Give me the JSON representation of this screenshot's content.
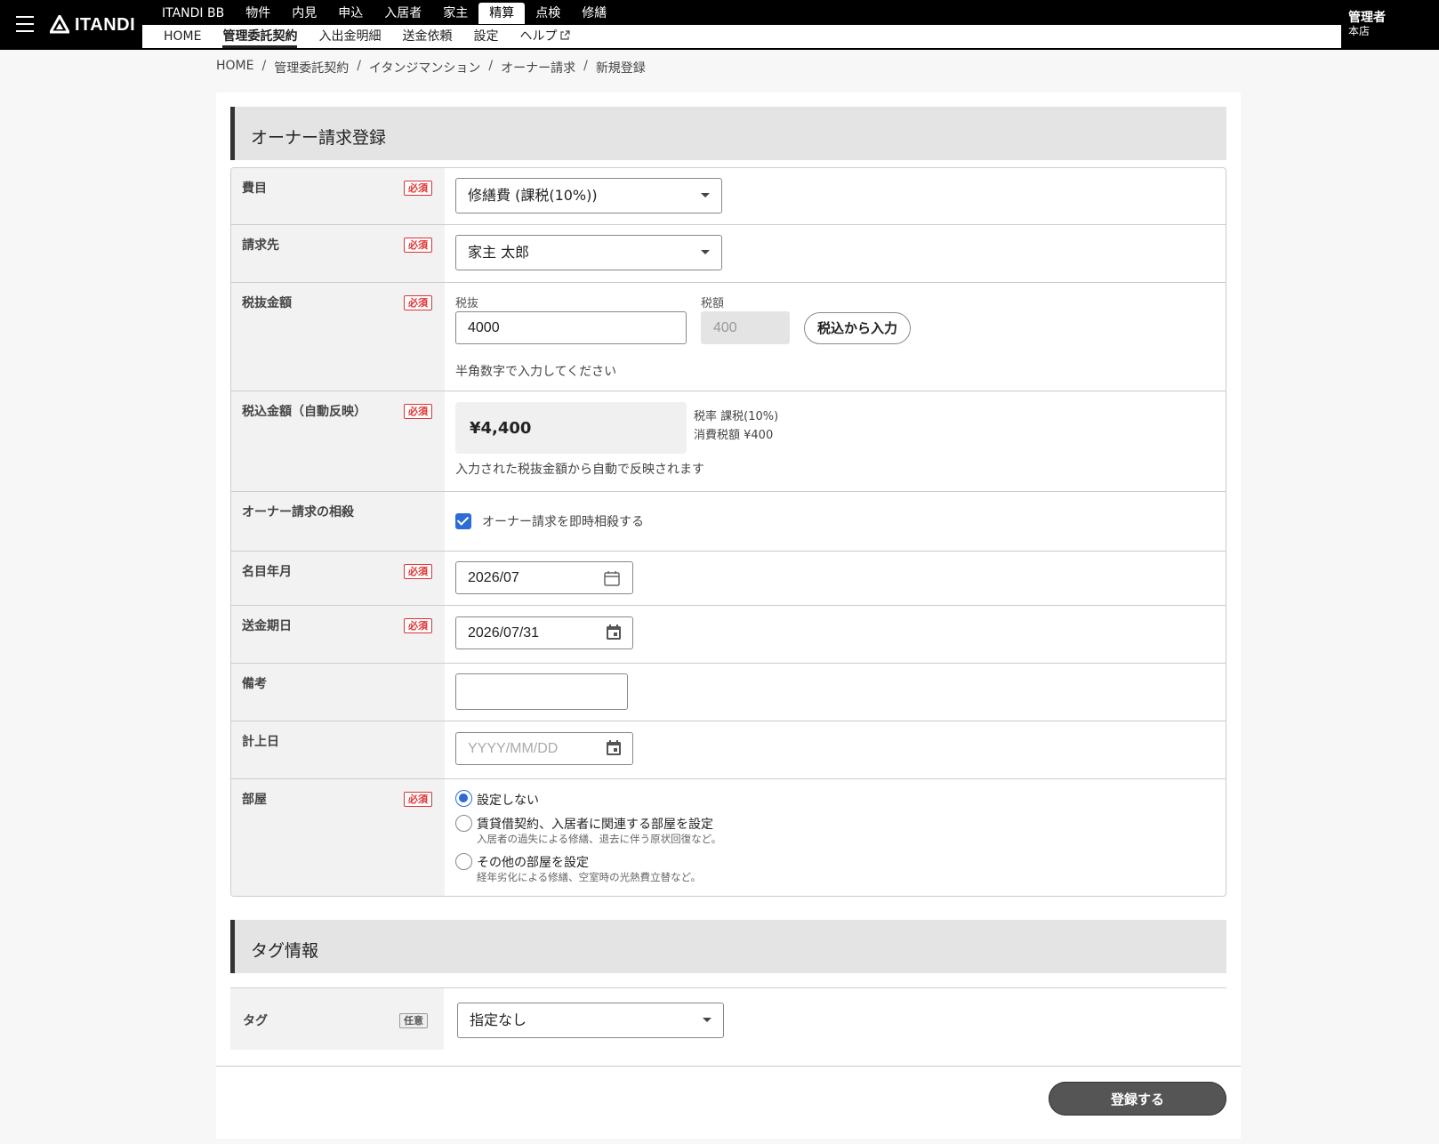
{
  "header": {
    "logo_text": "ITANDI",
    "top_nav": [
      "ITANDI BB",
      "物件",
      "内見",
      "申込",
      "入居者",
      "家主",
      "精算",
      "点検",
      "修繕"
    ],
    "top_nav_active": "精算",
    "sub_nav": [
      "HOME",
      "管理委託契約",
      "入出金明細",
      "送金依頼",
      "設定",
      "ヘルプ"
    ],
    "sub_nav_active": "管理委託契約",
    "user_role": "管理者",
    "user_branch": "本店"
  },
  "breadcrumb": [
    "HOME",
    "管理委託契約",
    "イタンジマンション",
    "オーナー請求",
    "新規登録"
  ],
  "breadcrumb_separator": "/",
  "section_title": "オーナー請求登録",
  "required_badge": "必須",
  "optional_badge": "任意",
  "fields": {
    "expense_item": {
      "label": "費目",
      "value": "修繕費 (課税(10%))"
    },
    "billing_to": {
      "label": "請求先",
      "value": "家主 太郎"
    },
    "amount_excl": {
      "label": "税抜金額",
      "excl_label": "税抜",
      "excl_value": "4000",
      "tax_label": "税額",
      "tax_value": "400",
      "button_label": "税込から入力",
      "hint": "半角数字で入力してください"
    },
    "amount_incl": {
      "label": "税込金額（自動反映）",
      "value": "¥4,400",
      "tax_rate": "税率 課税(10%)",
      "tax_amount": "消費税額 ¥400",
      "hint": "入力された税抜金額から自動で反映されます"
    },
    "offset": {
      "label": "オーナー請求の相殺",
      "checkbox_label": "オーナー請求を即時相殺する",
      "checked": true
    },
    "nominal_month": {
      "label": "名目年月",
      "value": "2026/07"
    },
    "transfer_date": {
      "label": "送金期日",
      "value": "2026/07/31"
    },
    "remarks": {
      "label": "備考",
      "value": ""
    },
    "posting_date": {
      "label": "計上日",
      "placeholder": "YYYY/MM/DD"
    },
    "room": {
      "label": "部屋",
      "options": [
        {
          "label": "設定しない",
          "sub": "",
          "selected": true
        },
        {
          "label": "賃貸借契約、入居者に関連する部屋を設定",
          "sub": "入居者の過失による修繕、退去に伴う原状回復など。",
          "selected": false
        },
        {
          "label": "その他の部屋を設定",
          "sub": "経年劣化による修繕、空室時の光熱費立替など。",
          "selected": false
        }
      ]
    }
  },
  "tag_section": {
    "title": "タグ情報",
    "label": "タグ",
    "value": "指定なし"
  },
  "submit_label": "登録する",
  "colors": {
    "accent": "#2d6bd6",
    "header_bg": "#000000",
    "required": "#dd3333"
  }
}
